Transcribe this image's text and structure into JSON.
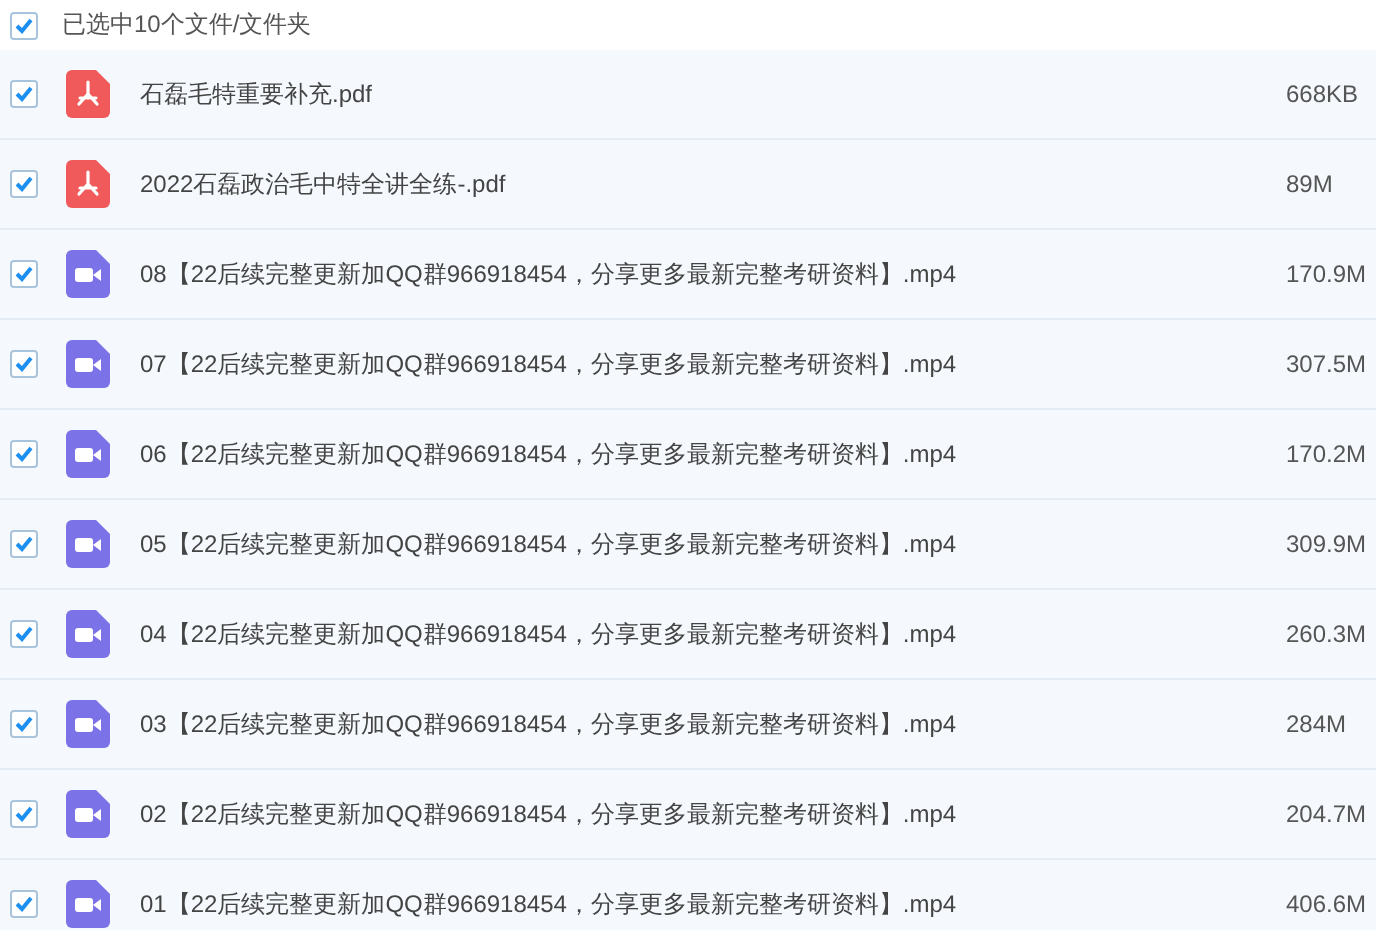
{
  "header": {
    "checked": true,
    "label": "已选中10个文件/文件夹"
  },
  "files": [
    {
      "kind": "pdf",
      "checked": true,
      "name": "石磊毛特重要补充.pdf",
      "size": "668KB"
    },
    {
      "kind": "pdf",
      "checked": true,
      "name": "2022石磊政治毛中特全讲全练-.pdf",
      "size": "89M"
    },
    {
      "kind": "video",
      "checked": true,
      "name": "08【22后续完整更新加QQ群966918454，分享更多最新完整考研资料】.mp4",
      "size": "170.9M"
    },
    {
      "kind": "video",
      "checked": true,
      "name": "07【22后续完整更新加QQ群966918454，分享更多最新完整考研资料】.mp4",
      "size": "307.5M"
    },
    {
      "kind": "video",
      "checked": true,
      "name": "06【22后续完整更新加QQ群966918454，分享更多最新完整考研资料】.mp4",
      "size": "170.2M"
    },
    {
      "kind": "video",
      "checked": true,
      "name": "05【22后续完整更新加QQ群966918454，分享更多最新完整考研资料】.mp4",
      "size": "309.9M"
    },
    {
      "kind": "video",
      "checked": true,
      "name": "04【22后续完整更新加QQ群966918454，分享更多最新完整考研资料】.mp4",
      "size": "260.3M"
    },
    {
      "kind": "video",
      "checked": true,
      "name": "03【22后续完整更新加QQ群966918454，分享更多最新完整考研资料】.mp4",
      "size": "284M"
    },
    {
      "kind": "video",
      "checked": true,
      "name": "02【22后续完整更新加QQ群966918454，分享更多最新完整考研资料】.mp4",
      "size": "204.7M"
    },
    {
      "kind": "video",
      "checked": true,
      "name": "01【22后续完整更新加QQ群966918454，分享更多最新完整考研资料】.mp4",
      "size": "406.6M"
    }
  ]
}
